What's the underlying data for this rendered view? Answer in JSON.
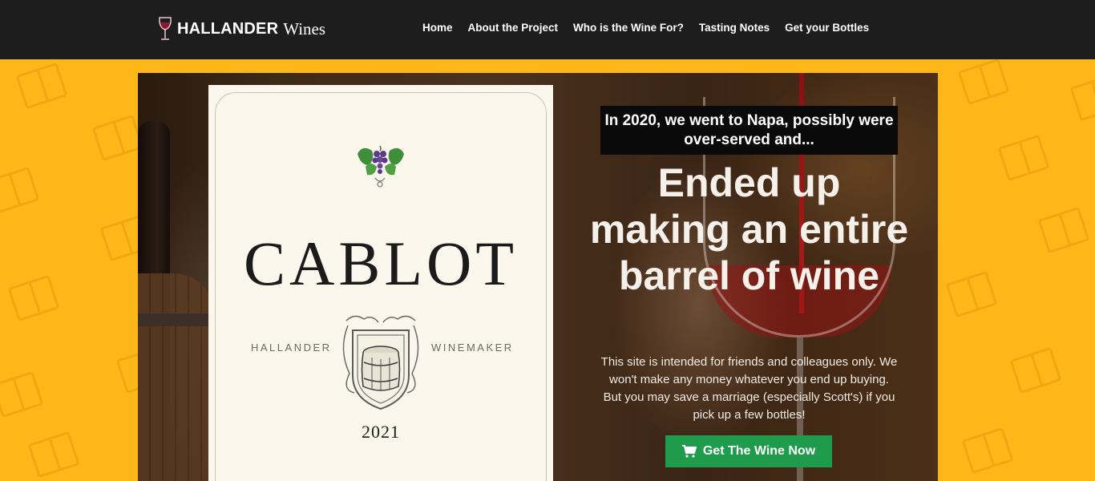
{
  "header": {
    "brand_bold": "HALLANDER",
    "brand_light": "Wines",
    "logo_icon": "wine-glass-icon",
    "nav": [
      {
        "label": "Home"
      },
      {
        "label": "About the Project"
      },
      {
        "label": "Who is the Wine For?"
      },
      {
        "label": "Tasting Notes"
      },
      {
        "label": "Get your Bottles"
      }
    ]
  },
  "label": {
    "name": "CABLOT",
    "left_text": "HALLANDER",
    "right_text": "WINEMAKER",
    "year": "2021",
    "grape_icon": "grape-leaf-icon",
    "crest_icon": "barrel-crest-icon"
  },
  "hero": {
    "tagline": "In 2020, we went to Napa, possibly were over-served and...",
    "headline": "Ended up making an entire barrel of wine",
    "description": "This site is intended for friends and colleagues only. We won't make any money whatever you end up buying. But you may save a marriage (especially Scott's) if you pick up a few bottles!",
    "cta_label": "Get The Wine Now",
    "cta_icon": "cart-icon"
  },
  "colors": {
    "page_bg": "#FDB718",
    "header_bg": "#1D1D1D",
    "cta_bg": "#1F9C4B",
    "label_bg": "#FBF7EC"
  }
}
